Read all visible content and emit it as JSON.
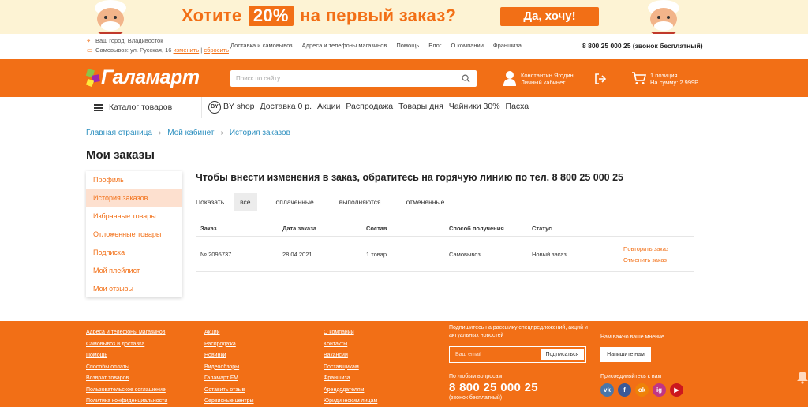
{
  "promo": {
    "text_before": "Хотите",
    "badge": "20%",
    "text_after": "на первый заказ?",
    "button": "Да, хочу!"
  },
  "topbar": {
    "city": "Ваш город: Владивосток",
    "pickup": "Самовывоз: ул. Русская, 16",
    "change": "изменить",
    "reset": "сбросить",
    "nav": [
      "Доставка и самовывоз",
      "Адреса и телефоны магазинов",
      "Помощь",
      "Блог",
      "О компании",
      "Франшиза"
    ],
    "phone": "8 800 25 000 25 (звонок бесплатный)"
  },
  "header": {
    "logo": "Галамарт",
    "search_placeholder": "Поиск по сайту",
    "user_name": "Константин Ягодин",
    "user_cabinet": "Личный кабинет",
    "cart_count": "1 позиция",
    "cart_sum": "На сумму: 2 999Р"
  },
  "catnav": {
    "catalog": "Каталог товаров",
    "by_logo": "BY",
    "links": [
      "BY shop",
      "Доставка 0 р.",
      "Акции",
      "Распродажа",
      "Товары дня",
      "Чайники 30%",
      "Пасха"
    ]
  },
  "breadcrumb": [
    "Главная страница",
    "Мой кабинет",
    "История заказов"
  ],
  "page_title": "Мои заказы",
  "sidebar": [
    "Профиль",
    "История заказов",
    "Избранные товары",
    "Отложенные товары",
    "Подписка",
    "Мой плейлист",
    "Мои отзывы"
  ],
  "notice": "Чтобы внести изменения в заказ, обратитесь на горячую линию по тел. 8 800 25 000 25",
  "filters": {
    "label": "Показать",
    "options": [
      "все",
      "оплаченные",
      "выполняются",
      "отмененные"
    ]
  },
  "table": {
    "headers": [
      "Заказ",
      "Дата заказа",
      "Состав",
      "Способ получения",
      "Статус"
    ],
    "rows": [
      {
        "order": "№ 2095737",
        "date": "28.04.2021",
        "items": "1 товар",
        "method": "Самовывоз",
        "status": "Новый заказ",
        "repeat": "Повторить заказ",
        "cancel": "Отменить заказ"
      }
    ]
  },
  "footer": {
    "col1": [
      "Адреса и телефоны магазинов",
      "Самовывоз и доставка",
      "Помощь",
      "Способы оплаты",
      "Возврат товаров",
      "Пользовательское соглашение",
      "Политика конфиденциальности"
    ],
    "col2": [
      "Акции",
      "Распродажа",
      "Новинки",
      "Видеообзоры",
      "Галамарт FM",
      "Оставить отзыв",
      "Сервисные центры"
    ],
    "col3": [
      "О компании",
      "Контакты",
      "Вакансии",
      "Поставщикам",
      "Франшиза",
      "Арендодателям",
      "Юридическим лицам"
    ],
    "subscribe_text": "Подпишитесь на рассылку спецпредложений, акций и актуальных новостей",
    "email_placeholder": "Ваш email",
    "subscribe_btn": "Подписаться",
    "questions": "По любым вопросам:",
    "phone": "8 800 25 000 25",
    "free": "(звонок бесплатный)",
    "opinion": "Нам важно ваше мнение",
    "opinion_btn": "Напишите нам",
    "join": "Присоединяйтесь к нам",
    "social": [
      "vk-icon",
      "facebook-icon",
      "odnoklassniki-icon",
      "instagram-icon",
      "youtube-icon"
    ],
    "social_letters": [
      "vk",
      "f",
      "ok",
      "ig",
      "▶"
    ]
  },
  "colors": {
    "brand": "#f26f16",
    "link": "#2c8fbf",
    "active_bg": "#fde0cf"
  }
}
